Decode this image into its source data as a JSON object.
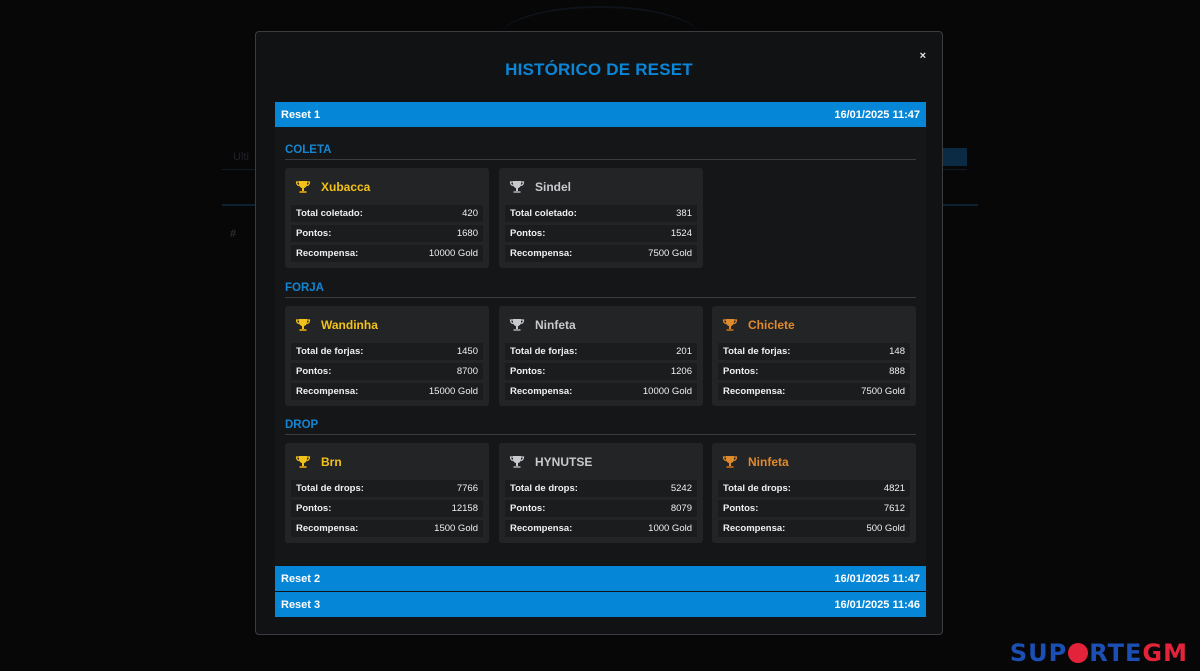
{
  "modal": {
    "title": "HISTÓRICO DE RESET",
    "close_label": "×"
  },
  "background": {
    "search_fragment": "Ulti",
    "table_hash": "#"
  },
  "watermark": {
    "part1": "SUP",
    "part2": "RTE",
    "part3": "GM"
  },
  "resets": [
    {
      "label": "Reset 1",
      "datetime": "16/01/2025 11:47",
      "expanded": true,
      "sections": [
        {
          "title": "COLETA",
          "cards": [
            {
              "rank": "gold",
              "name": "Xubacca",
              "stats": [
                {
                  "label": "Total coletado:",
                  "value": "420"
                },
                {
                  "label": "Pontos:",
                  "value": "1680"
                },
                {
                  "label": "Recompensa:",
                  "value": "10000 Gold"
                }
              ]
            },
            {
              "rank": "silver",
              "name": "Sindel",
              "stats": [
                {
                  "label": "Total coletado:",
                  "value": "381"
                },
                {
                  "label": "Pontos:",
                  "value": "1524"
                },
                {
                  "label": "Recompensa:",
                  "value": "7500 Gold"
                }
              ]
            }
          ]
        },
        {
          "title": "FORJA",
          "cards": [
            {
              "rank": "gold",
              "name": "Wandinha",
              "stats": [
                {
                  "label": "Total de forjas:",
                  "value": "1450"
                },
                {
                  "label": "Pontos:",
                  "value": "8700"
                },
                {
                  "label": "Recompensa:",
                  "value": "15000 Gold"
                }
              ]
            },
            {
              "rank": "silver",
              "name": "Ninfeta",
              "stats": [
                {
                  "label": "Total de forjas:",
                  "value": "201"
                },
                {
                  "label": "Pontos:",
                  "value": "1206"
                },
                {
                  "label": "Recompensa:",
                  "value": "10000 Gold"
                }
              ]
            },
            {
              "rank": "bronze",
              "name": "Chiclete",
              "stats": [
                {
                  "label": "Total de forjas:",
                  "value": "148"
                },
                {
                  "label": "Pontos:",
                  "value": "888"
                },
                {
                  "label": "Recompensa:",
                  "value": "7500 Gold"
                }
              ]
            }
          ]
        },
        {
          "title": "DROP",
          "cards": [
            {
              "rank": "gold",
              "name": "Brn",
              "stats": [
                {
                  "label": "Total de drops:",
                  "value": "7766"
                },
                {
                  "label": "Pontos:",
                  "value": "12158"
                },
                {
                  "label": "Recompensa:",
                  "value": "1500 Gold"
                }
              ]
            },
            {
              "rank": "silver",
              "name": "HYNUTSE",
              "stats": [
                {
                  "label": "Total de drops:",
                  "value": "5242"
                },
                {
                  "label": "Pontos:",
                  "value": "8079"
                },
                {
                  "label": "Recompensa:",
                  "value": "1000 Gold"
                }
              ]
            },
            {
              "rank": "bronze",
              "name": "Ninfeta",
              "stats": [
                {
                  "label": "Total de drops:",
                  "value": "4821"
                },
                {
                  "label": "Pontos:",
                  "value": "7612"
                },
                {
                  "label": "Recompensa:",
                  "value": "500 Gold"
                }
              ]
            }
          ]
        }
      ]
    },
    {
      "label": "Reset 2",
      "datetime": "16/01/2025 11:47",
      "expanded": false
    },
    {
      "label": "Reset 3",
      "datetime": "16/01/2025 11:46",
      "expanded": false
    }
  ],
  "colors": {
    "accent": "#0686d6",
    "gold": "#f3c21a",
    "silver": "#c8c9cc",
    "bronze": "#e08a2e"
  }
}
